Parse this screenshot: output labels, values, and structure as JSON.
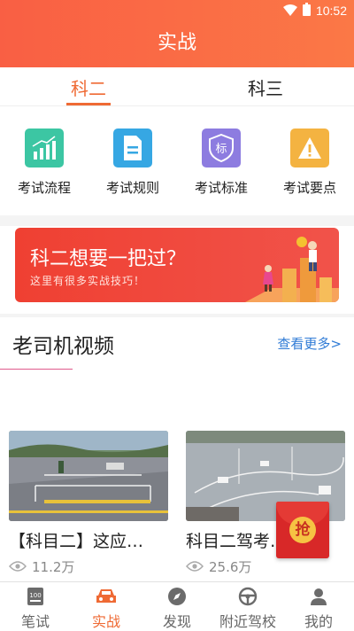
{
  "status_bar": {
    "time": "10:52"
  },
  "header": {
    "title": "实战"
  },
  "tabs": [
    {
      "label": "科二",
      "active": true
    },
    {
      "label": "科三",
      "active": false
    }
  ],
  "grid": [
    {
      "label": "考试流程",
      "icon": "bar-chart-icon",
      "color": "#3cc6a3"
    },
    {
      "label": "考试规则",
      "icon": "document-icon",
      "color": "#36a7e3"
    },
    {
      "label": "考试标准",
      "icon": "badge-standard-icon",
      "color": "#8d7ce0",
      "icon_text": "标"
    },
    {
      "label": "考试要点",
      "icon": "warning-icon",
      "color": "#f4b341"
    }
  ],
  "banner": {
    "title": "科二想要一把过？",
    "subtitle": "这里有很多实战技巧！"
  },
  "section": {
    "title": "老司机视频",
    "more": "查看更多>"
  },
  "videos": [
    {
      "title": "【科目二】这应…",
      "views": "11.2万"
    },
    {
      "title": "科目二驾考…",
      "views": "25.6万"
    }
  ],
  "envelope": {
    "label": "抢"
  },
  "bottom_nav": [
    {
      "label": "笔试",
      "icon": "exam-paper-icon",
      "active": false
    },
    {
      "label": "实战",
      "icon": "car-icon",
      "active": true
    },
    {
      "label": "发现",
      "icon": "compass-icon",
      "active": false
    },
    {
      "label": "附近驾校",
      "icon": "steering-wheel-icon",
      "active": false
    },
    {
      "label": "我的",
      "icon": "profile-icon",
      "active": false
    }
  ],
  "colors": {
    "accent": "#ef6a34",
    "link": "#2f7bd6",
    "banner": "#ef4032"
  }
}
